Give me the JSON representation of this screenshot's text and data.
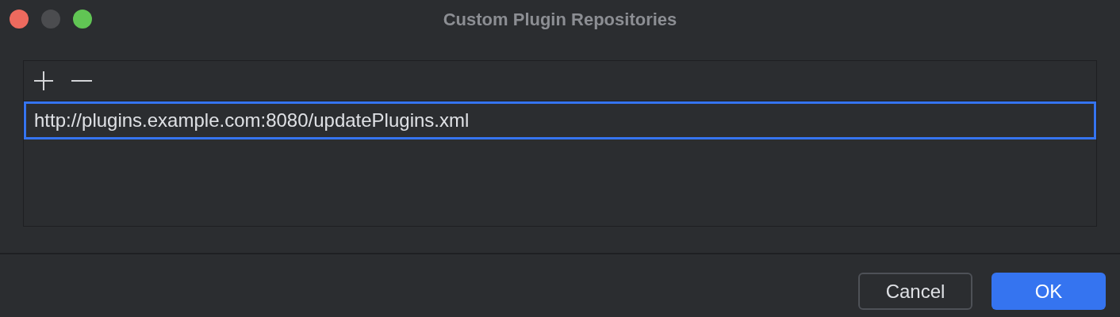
{
  "window": {
    "title": "Custom Plugin Repositories",
    "controls": [
      {
        "kind": "close",
        "disabled": false
      },
      {
        "kind": "minimize",
        "disabled": true
      },
      {
        "kind": "zoom",
        "disabled": false
      }
    ]
  },
  "toolbar": [
    {
      "kind": "add"
    },
    {
      "kind": "remove"
    }
  ],
  "repositories": [
    {
      "url": "http://plugins.example.com:8080/updatePlugins.xml",
      "selected": true
    }
  ],
  "buttons": [
    {
      "label": "Cancel",
      "default": false
    },
    {
      "label": "OK",
      "default": true
    }
  ]
}
